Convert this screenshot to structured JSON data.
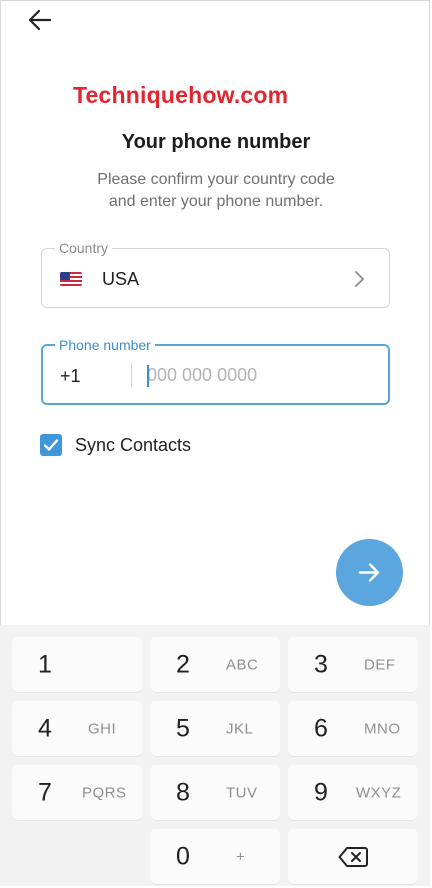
{
  "watermark": "Techniquehow.com",
  "title": "Your phone number",
  "subtitle_line1": "Please confirm your country code",
  "subtitle_line2": "and enter your phone number.",
  "country_field": {
    "label": "Country",
    "value": "USA",
    "flag": "us-flag-icon"
  },
  "phone_field": {
    "label": "Phone number",
    "code": "+1",
    "value": "",
    "placeholder": "000 000 0000"
  },
  "sync": {
    "label": "Sync Contacts",
    "checked": true
  },
  "colors": {
    "accent": "#3f97d9",
    "fab": "#5ca6e0",
    "watermark": "#e3262e"
  },
  "keypad": {
    "keys": [
      {
        "digit": "1",
        "letters": ""
      },
      {
        "digit": "2",
        "letters": "ABC"
      },
      {
        "digit": "3",
        "letters": "DEF"
      },
      {
        "digit": "4",
        "letters": "GHI"
      },
      {
        "digit": "5",
        "letters": "JKL"
      },
      {
        "digit": "6",
        "letters": "MNO"
      },
      {
        "digit": "7",
        "letters": "PQRS"
      },
      {
        "digit": "8",
        "letters": "TUV"
      },
      {
        "digit": "9",
        "letters": "WXYZ"
      },
      {
        "digit": "0",
        "letters": "+"
      }
    ]
  }
}
